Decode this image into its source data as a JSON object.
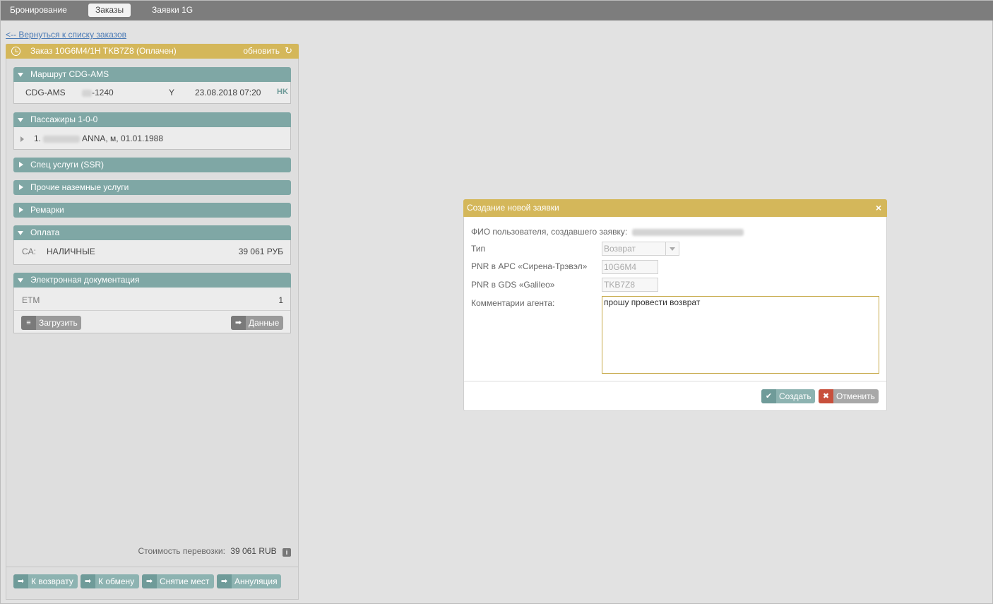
{
  "nav": {
    "items": [
      {
        "label": "Бронирование"
      },
      {
        "label": "Заказы"
      },
      {
        "label": "Заявки 1G"
      }
    ]
  },
  "back_link": "<-- Вернуться к списку заказов",
  "order": {
    "title": "Заказ 10G6M4/1H TKB7Z8 (Оплачен)",
    "refresh_label": "обновить",
    "route": {
      "header": "Маршрут  CDG-AMS",
      "segment": {
        "route": "CDG-AMS",
        "flight": "-1240",
        "class": "Y",
        "datetime": "23.08.2018 07:20",
        "status": "HK"
      }
    },
    "passengers": {
      "header": "Пассажиры 1-0-0",
      "items": [
        {
          "num": "1.",
          "details": "ANNA, м, 01.01.1988"
        }
      ]
    },
    "ssr_header": "Спец услуги (SSR)",
    "ground_header": "Прочие наземные услуги",
    "remarks_header": "Ремарки",
    "payment": {
      "header": "Оплата",
      "code": "CA:",
      "method": "НАЛИЧНЫЕ",
      "amount": "39 061 РУБ"
    },
    "edocs": {
      "header": "Электронная документация",
      "type": "ETM",
      "count": "1",
      "upload_label": "Загрузить",
      "data_label": "Данные"
    },
    "cost_label": "Стоимость перевозки:",
    "cost_value": "39 061 RUB",
    "actions": {
      "refund": "К возврату",
      "exchange": "К обмену",
      "cancel_seats": "Снятие мест",
      "void": "Аннуляция"
    }
  },
  "modal": {
    "title": "Создание новой заявки",
    "creator_label": "ФИО пользователя, создавшего заявку:",
    "type_label": "Тип",
    "type_value": "Возврат",
    "pnr_apc_label": "PNR в АРС «Сирена-Трэвэл»",
    "pnr_apc_value": "10G6M4",
    "pnr_gds_label": "PNR в GDS «Galileo»",
    "pnr_gds_value": "TKB7Z8",
    "comment_label": "Комментарии агента:",
    "comment_value": "прошу провести возврат",
    "create_label": "Создать",
    "cancel_label": "Отменить"
  },
  "colors": {
    "accent_gold": "#d4b75a",
    "section_teal": "#7fa7a5",
    "cancel_red": "#c8503c"
  }
}
